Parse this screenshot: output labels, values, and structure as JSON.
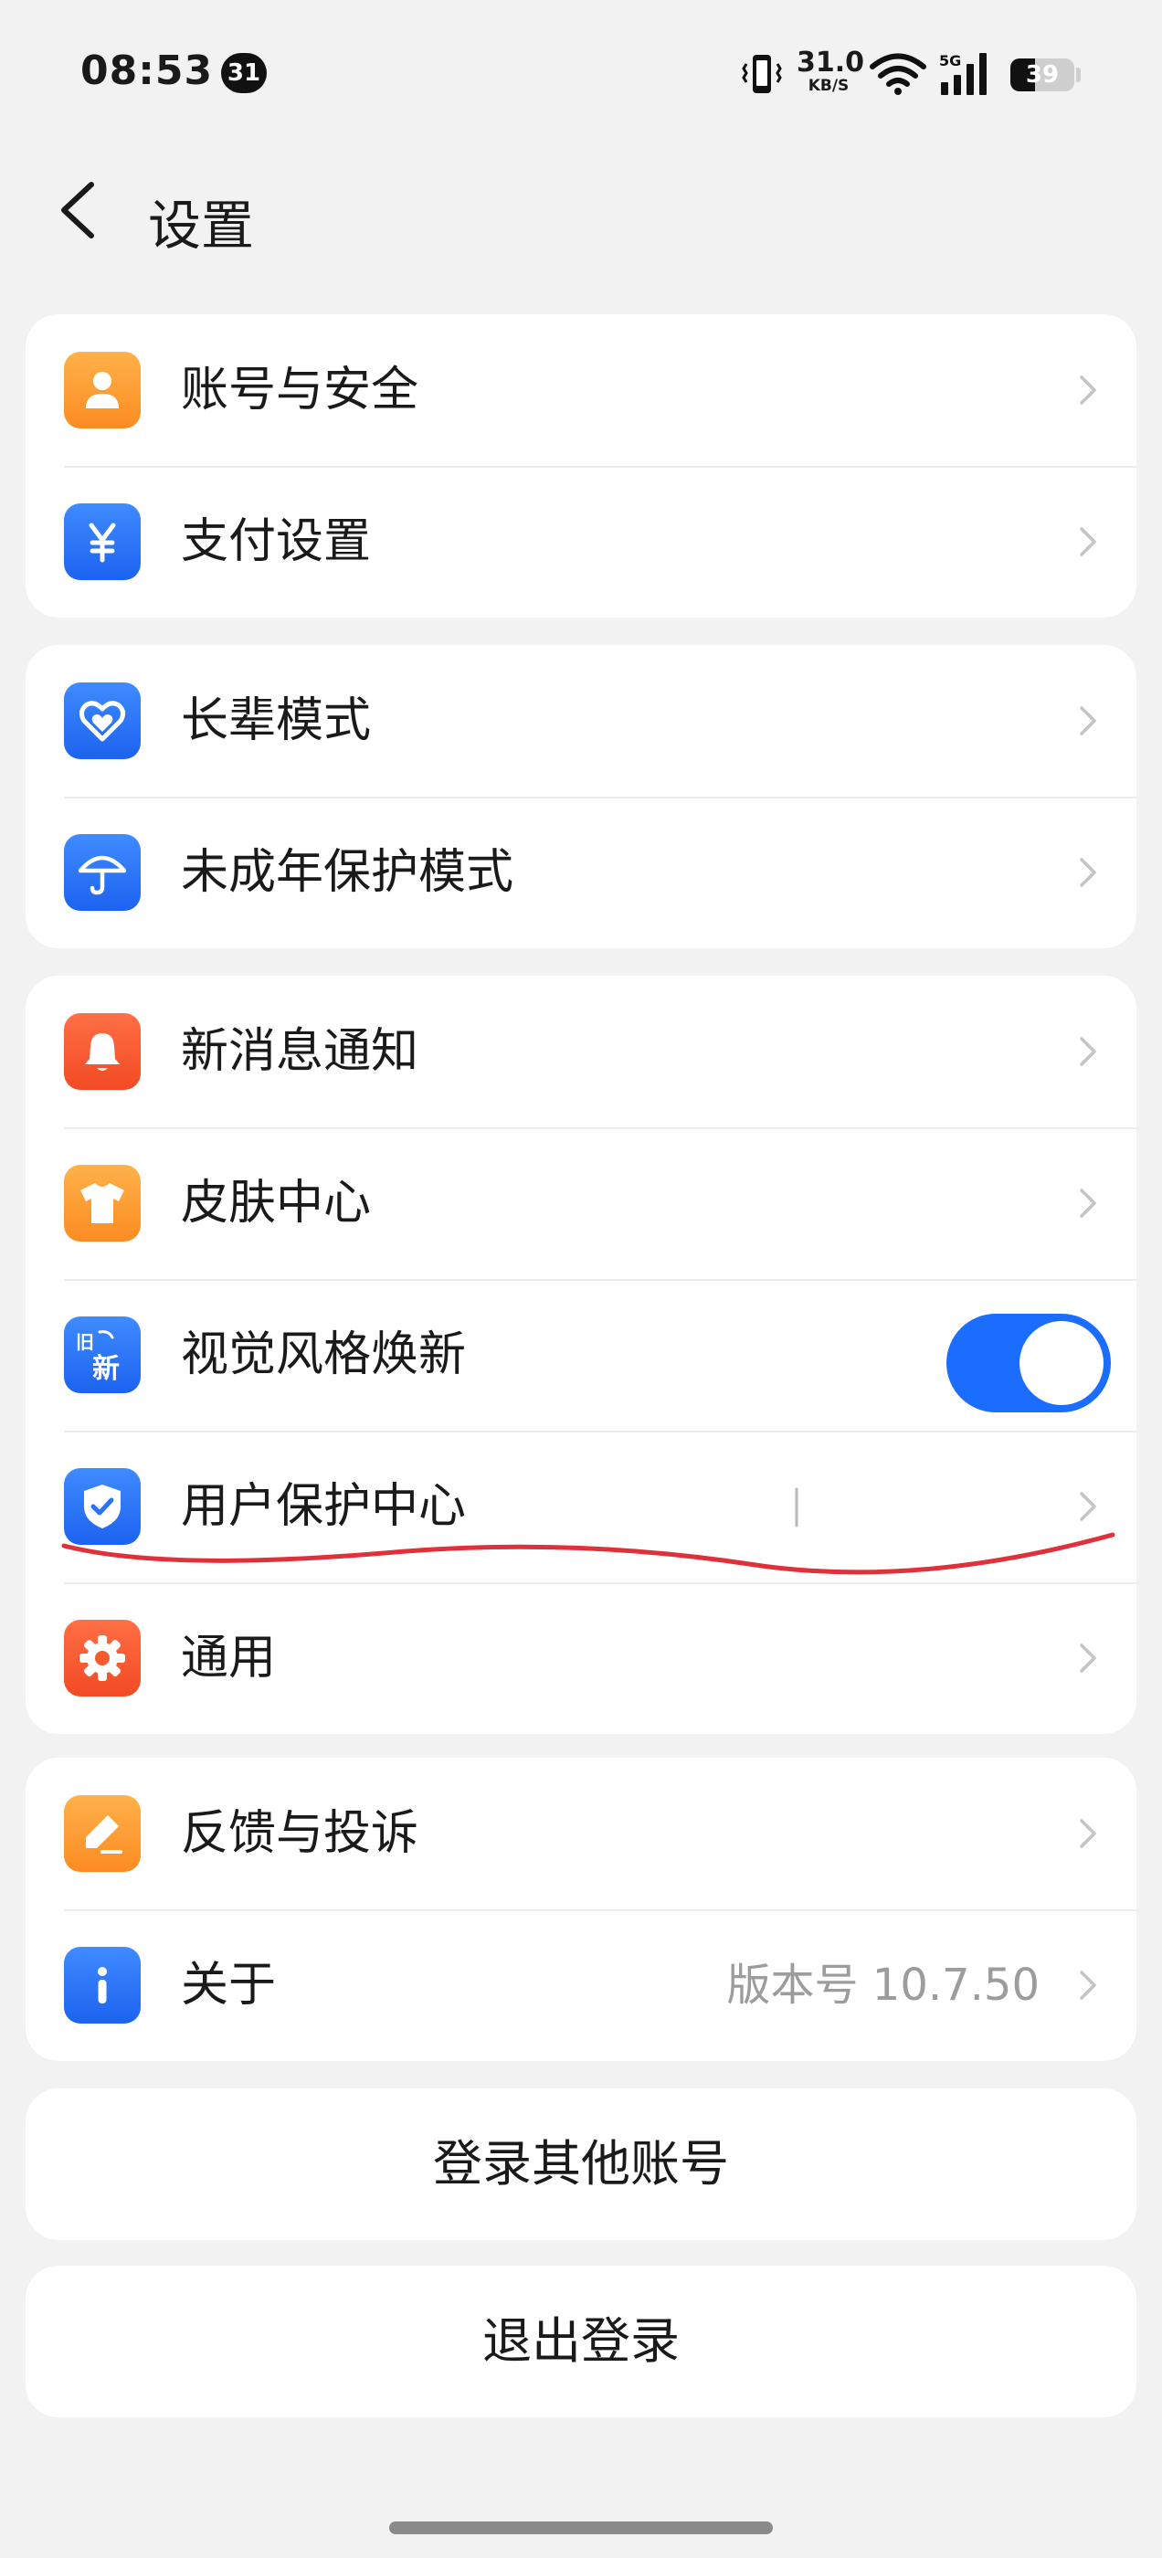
{
  "status_bar": {
    "time": "08:53",
    "notification_badge": "31",
    "net_speed_value": "31.0",
    "net_speed_unit": "KB/S",
    "network_type": "5G",
    "battery_percent": "39",
    "battery_level": 0.39
  },
  "header": {
    "title": "设置",
    "back_icon": "chevron-left-icon"
  },
  "groups": [
    {
      "items": [
        {
          "label": "账号与安全",
          "icon": "user-icon",
          "color": "#fb9a2f"
        },
        {
          "label": "支付设置",
          "icon": "yen-icon",
          "color": "#2a72f6"
        }
      ]
    },
    {
      "items": [
        {
          "label": "长辈模式",
          "icon": "heart-icon",
          "color": "#2a72f6"
        },
        {
          "label": "未成年保护模式",
          "icon": "umbrella-icon",
          "color": "#2a72f6"
        }
      ]
    },
    {
      "items": [
        {
          "label": "新消息通知",
          "icon": "bell-icon",
          "color": "#f45a2c"
        },
        {
          "label": "皮肤中心",
          "icon": "shirt-icon",
          "color": "#fb9a2f"
        },
        {
          "label": "视觉风格焕新",
          "icon": "old-new-icon",
          "icon_text_old": "旧",
          "icon_text_new": "新",
          "color": "#2a72f6",
          "toggle_on": true
        },
        {
          "label": "用户保护中心",
          "icon": "shield-check-icon",
          "color": "#2a72f6"
        },
        {
          "label": "通用",
          "icon": "gear-icon",
          "color": "#f45a2c"
        }
      ]
    },
    {
      "items": [
        {
          "label": "反馈与投诉",
          "icon": "pencil-icon",
          "color": "#fb9a2f"
        },
        {
          "label": "关于",
          "icon": "info-icon",
          "color": "#2a72f6",
          "value": "版本号 10.7.50"
        }
      ]
    }
  ],
  "actions": {
    "switch_account": "登录其他账号",
    "logout": "退出登录"
  },
  "colors": {
    "accent": "#1a6dff",
    "annotation": "#e0303a",
    "background": "#f2f2f2"
  }
}
